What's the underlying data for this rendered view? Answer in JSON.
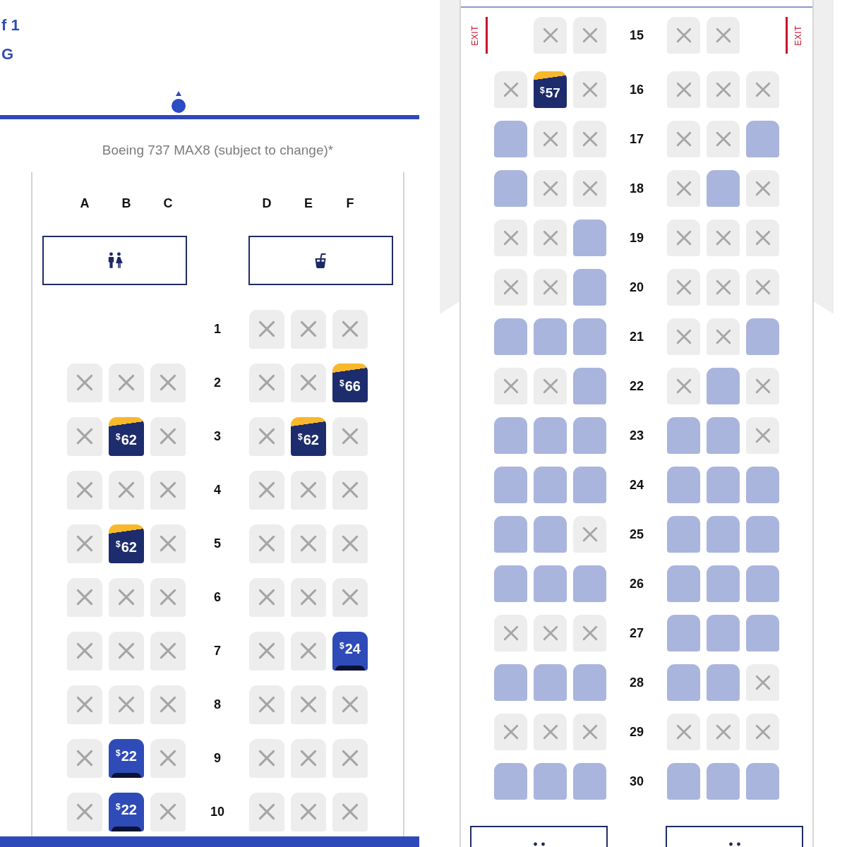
{
  "header": {
    "line_1": "f 1",
    "line_2": "G"
  },
  "aircraft": "Boeing 737 MAX8 (subject to change)*",
  "front_cabin": {
    "columns": [
      "A",
      "B",
      "C",
      "D",
      "E",
      "F"
    ],
    "facilities": [
      {
        "kind": "lavatory"
      },
      {
        "kind": "galley"
      }
    ],
    "rows": [
      {
        "number": "1",
        "seats": [
          {
            "kind": "empty"
          },
          {
            "kind": "empty"
          },
          {
            "kind": "empty"
          },
          {
            "kind": "taken"
          },
          {
            "kind": "taken"
          },
          {
            "kind": "taken"
          }
        ]
      },
      {
        "number": "2",
        "seats": [
          {
            "kind": "taken"
          },
          {
            "kind": "taken"
          },
          {
            "kind": "taken"
          },
          {
            "kind": "taken"
          },
          {
            "kind": "taken"
          },
          {
            "kind": "premium",
            "currency": "$",
            "amount": "66"
          }
        ]
      },
      {
        "number": "3",
        "seats": [
          {
            "kind": "taken"
          },
          {
            "kind": "premium",
            "currency": "$",
            "amount": "62"
          },
          {
            "kind": "taken"
          },
          {
            "kind": "taken"
          },
          {
            "kind": "premium",
            "currency": "$",
            "amount": "62"
          },
          {
            "kind": "taken"
          }
        ]
      },
      {
        "number": "4",
        "seats": [
          {
            "kind": "taken"
          },
          {
            "kind": "taken"
          },
          {
            "kind": "taken"
          },
          {
            "kind": "taken"
          },
          {
            "kind": "taken"
          },
          {
            "kind": "taken"
          }
        ]
      },
      {
        "number": "5",
        "seats": [
          {
            "kind": "taken"
          },
          {
            "kind": "premium",
            "currency": "$",
            "amount": "62"
          },
          {
            "kind": "taken"
          },
          {
            "kind": "taken"
          },
          {
            "kind": "taken"
          },
          {
            "kind": "taken"
          }
        ]
      },
      {
        "number": "6",
        "seats": [
          {
            "kind": "taken"
          },
          {
            "kind": "taken"
          },
          {
            "kind": "taken"
          },
          {
            "kind": "taken"
          },
          {
            "kind": "taken"
          },
          {
            "kind": "taken"
          }
        ]
      },
      {
        "number": "7",
        "seats": [
          {
            "kind": "taken"
          },
          {
            "kind": "taken"
          },
          {
            "kind": "taken"
          },
          {
            "kind": "taken"
          },
          {
            "kind": "taken"
          },
          {
            "kind": "preferred",
            "currency": "$",
            "amount": "24"
          }
        ]
      },
      {
        "number": "8",
        "seats": [
          {
            "kind": "taken"
          },
          {
            "kind": "taken"
          },
          {
            "kind": "taken"
          },
          {
            "kind": "taken"
          },
          {
            "kind": "taken"
          },
          {
            "kind": "taken"
          }
        ]
      },
      {
        "number": "9",
        "seats": [
          {
            "kind": "taken"
          },
          {
            "kind": "preferred",
            "currency": "$",
            "amount": "22"
          },
          {
            "kind": "taken"
          },
          {
            "kind": "taken"
          },
          {
            "kind": "taken"
          },
          {
            "kind": "taken"
          }
        ]
      },
      {
        "number": "10",
        "seats": [
          {
            "kind": "taken"
          },
          {
            "kind": "preferred",
            "currency": "$",
            "amount": "22"
          },
          {
            "kind": "taken"
          },
          {
            "kind": "taken"
          },
          {
            "kind": "taken"
          },
          {
            "kind": "taken"
          }
        ]
      }
    ]
  },
  "rear_cabin": {
    "rows": [
      {
        "number": "15",
        "exit_left": "EXIT",
        "exit_right": "EXIT",
        "seats": [
          {
            "kind": "empty"
          },
          {
            "kind": "taken"
          },
          {
            "kind": "taken"
          },
          {
            "kind": "taken"
          },
          {
            "kind": "taken"
          },
          {
            "kind": "empty"
          }
        ]
      },
      {
        "number": "16",
        "seats": [
          {
            "kind": "taken"
          },
          {
            "kind": "premium",
            "currency": "$",
            "amount": "57"
          },
          {
            "kind": "taken"
          },
          {
            "kind": "taken"
          },
          {
            "kind": "taken"
          },
          {
            "kind": "taken"
          }
        ]
      },
      {
        "number": "17",
        "seats": [
          {
            "kind": "open"
          },
          {
            "kind": "taken"
          },
          {
            "kind": "taken"
          },
          {
            "kind": "taken"
          },
          {
            "kind": "taken"
          },
          {
            "kind": "open"
          }
        ]
      },
      {
        "number": "18",
        "seats": [
          {
            "kind": "open"
          },
          {
            "kind": "taken"
          },
          {
            "kind": "taken"
          },
          {
            "kind": "taken"
          },
          {
            "kind": "open"
          },
          {
            "kind": "taken"
          }
        ]
      },
      {
        "number": "19",
        "seats": [
          {
            "kind": "taken"
          },
          {
            "kind": "taken"
          },
          {
            "kind": "open"
          },
          {
            "kind": "taken"
          },
          {
            "kind": "taken"
          },
          {
            "kind": "taken"
          }
        ]
      },
      {
        "number": "20",
        "seats": [
          {
            "kind": "taken"
          },
          {
            "kind": "taken"
          },
          {
            "kind": "open"
          },
          {
            "kind": "taken"
          },
          {
            "kind": "taken"
          },
          {
            "kind": "taken"
          }
        ]
      },
      {
        "number": "21",
        "seats": [
          {
            "kind": "open"
          },
          {
            "kind": "open"
          },
          {
            "kind": "open"
          },
          {
            "kind": "taken"
          },
          {
            "kind": "taken"
          },
          {
            "kind": "open"
          }
        ]
      },
      {
        "number": "22",
        "seats": [
          {
            "kind": "taken"
          },
          {
            "kind": "taken"
          },
          {
            "kind": "open"
          },
          {
            "kind": "taken"
          },
          {
            "kind": "open"
          },
          {
            "kind": "taken"
          }
        ]
      },
      {
        "number": "23",
        "seats": [
          {
            "kind": "open"
          },
          {
            "kind": "open"
          },
          {
            "kind": "open"
          },
          {
            "kind": "open"
          },
          {
            "kind": "open"
          },
          {
            "kind": "taken"
          }
        ]
      },
      {
        "number": "24",
        "seats": [
          {
            "kind": "open"
          },
          {
            "kind": "open"
          },
          {
            "kind": "open"
          },
          {
            "kind": "open"
          },
          {
            "kind": "open"
          },
          {
            "kind": "open"
          }
        ]
      },
      {
        "number": "25",
        "seats": [
          {
            "kind": "open"
          },
          {
            "kind": "open"
          },
          {
            "kind": "taken"
          },
          {
            "kind": "open"
          },
          {
            "kind": "open"
          },
          {
            "kind": "open"
          }
        ]
      },
      {
        "number": "26",
        "seats": [
          {
            "kind": "open"
          },
          {
            "kind": "open"
          },
          {
            "kind": "open"
          },
          {
            "kind": "open"
          },
          {
            "kind": "open"
          },
          {
            "kind": "open"
          }
        ]
      },
      {
        "number": "27",
        "seats": [
          {
            "kind": "taken"
          },
          {
            "kind": "taken"
          },
          {
            "kind": "taken"
          },
          {
            "kind": "open"
          },
          {
            "kind": "open"
          },
          {
            "kind": "open"
          }
        ]
      },
      {
        "number": "28",
        "seats": [
          {
            "kind": "open"
          },
          {
            "kind": "open"
          },
          {
            "kind": "open"
          },
          {
            "kind": "open"
          },
          {
            "kind": "open"
          },
          {
            "kind": "taken"
          }
        ]
      },
      {
        "number": "29",
        "seats": [
          {
            "kind": "taken"
          },
          {
            "kind": "taken"
          },
          {
            "kind": "taken"
          },
          {
            "kind": "taken"
          },
          {
            "kind": "taken"
          },
          {
            "kind": "taken"
          }
        ]
      },
      {
        "number": "30",
        "seats": [
          {
            "kind": "open"
          },
          {
            "kind": "open"
          },
          {
            "kind": "open"
          },
          {
            "kind": "open"
          },
          {
            "kind": "open"
          },
          {
            "kind": "open"
          }
        ]
      }
    ],
    "facilities": [
      {
        "kind": "lavatory"
      },
      {
        "kind": "lavatory"
      }
    ]
  }
}
